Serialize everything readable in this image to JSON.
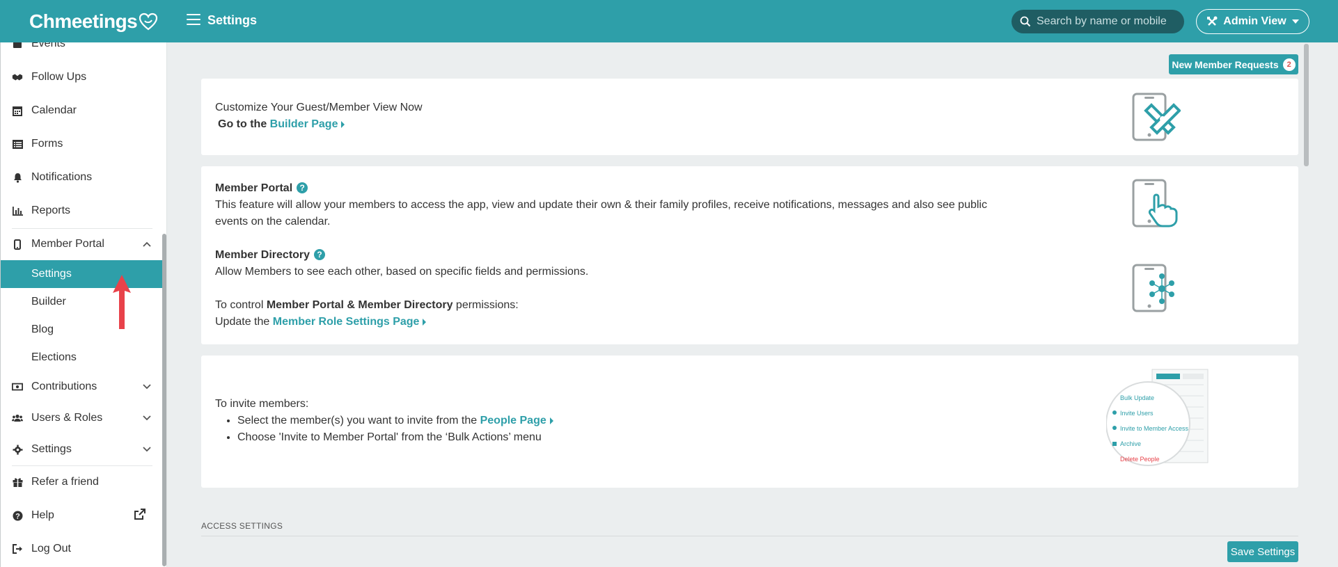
{
  "header": {
    "logo": "Chmeetings",
    "title": "Settings",
    "search_placeholder": "Search by name or mobile",
    "admin_view_label": "Admin View"
  },
  "sidebar": {
    "events": "Events",
    "follow_ups": "Follow Ups",
    "calendar": "Calendar",
    "forms": "Forms",
    "notifications": "Notifications",
    "reports": "Reports",
    "member_portal": "Member Portal",
    "member_portal_sub": {
      "settings": "Settings",
      "builder": "Builder",
      "blog": "Blog",
      "elections": "Elections"
    },
    "contributions": "Contributions",
    "users_roles": "Users & Roles",
    "settings": "Settings",
    "refer": "Refer a friend",
    "help": "Help",
    "logout": "Log Out"
  },
  "main": {
    "new_member_requests": "New Member Requests",
    "new_member_requests_count": "2",
    "builder_card": {
      "line1": "Customize Your Guest/Member View Now",
      "line2_prefix": "Go to the",
      "link": "Builder Page"
    },
    "portal_card": {
      "portal_title": "Member Portal",
      "portal_desc_1": "This feature will allow your members to access the app, view and update their own & their family profiles, receive notifications, messages and also see public",
      "portal_desc_2": "events on the calendar.",
      "directory_title": "Member Directory",
      "directory_desc": "Allow Members to see each other, based on specific fields and permissions.",
      "control_prefix": "To control",
      "control_bold": "Member Portal & Member Directory",
      "control_suffix": "permissions:",
      "update_prefix": "Update the",
      "update_link": "Member Role Settings Page"
    },
    "invite_card": {
      "title": "To invite members:",
      "step1_prefix": "Select the member(s) you want to invite from the",
      "step1_link": "People Page",
      "step2": "Choose 'Invite to Member Portal' from the ‘Bulk Actions’ menu",
      "menu_items": [
        "Bulk Update",
        "Invite Users",
        "Invite to Member Access",
        "Archive",
        "Delete People"
      ]
    },
    "access_settings": "ACCESS SETTINGS",
    "save_settings": "Save Settings"
  },
  "colors": {
    "primary": "#2e9fa9",
    "search_bg": "#1f5d63",
    "arrow": "#e8424a"
  }
}
